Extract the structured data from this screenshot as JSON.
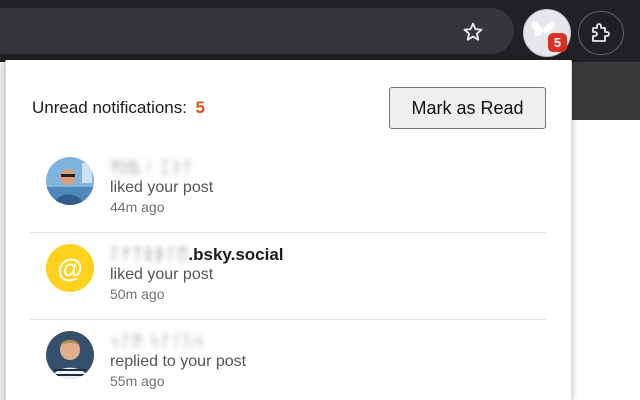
{
  "browser": {
    "extension_badge": "5"
  },
  "popup": {
    "unread_label": "Unread notifications:",
    "unread_count": "5",
    "mark_read_label": "Mark as Read"
  },
  "notifications": [
    {
      "author_obscured": "ᛡ̃ᛞᚣᛁ ᛈᚱᚨ",
      "author_suffix": "",
      "action": "liked your post",
      "time": "44m ago",
      "avatar": "photo-person-glasses"
    },
    {
      "author_obscured": "ᚴᚠᛏᚱᛒᛚᛖ",
      "author_suffix": ".bsky.social",
      "action": "liked your post",
      "time": "50m ago",
      "avatar": "at-sign-icon",
      "avatar_glyph": "@"
    },
    {
      "author_obscured": "ᛃᚨᛗ ᛋᚨᛚᚢᛋ",
      "author_suffix": "",
      "action": "replied to your post",
      "time": "55m ago",
      "avatar": "photo-person-striped-shirt"
    }
  ],
  "colors": {
    "accent": "#e8511a",
    "badge": "#d93025",
    "at_avatar": "#ffd21f"
  }
}
